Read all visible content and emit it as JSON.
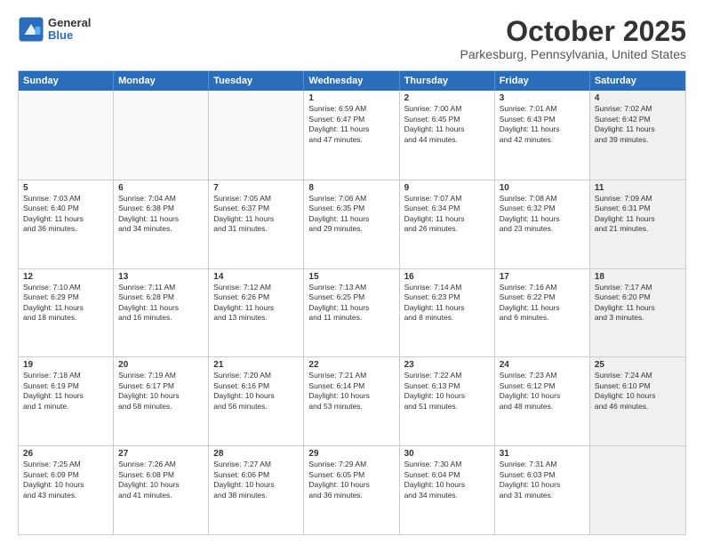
{
  "logo": {
    "general": "General",
    "blue": "Blue"
  },
  "title": {
    "month": "October 2025",
    "location": "Parkesburg, Pennsylvania, United States"
  },
  "calendar": {
    "headers": [
      "Sunday",
      "Monday",
      "Tuesday",
      "Wednesday",
      "Thursday",
      "Friday",
      "Saturday"
    ],
    "rows": [
      [
        {
          "day": "",
          "info": "",
          "empty": true
        },
        {
          "day": "",
          "info": "",
          "empty": true
        },
        {
          "day": "",
          "info": "",
          "empty": true
        },
        {
          "day": "1",
          "info": "Sunrise: 6:59 AM\nSunset: 6:47 PM\nDaylight: 11 hours\nand 47 minutes."
        },
        {
          "day": "2",
          "info": "Sunrise: 7:00 AM\nSunset: 6:45 PM\nDaylight: 11 hours\nand 44 minutes."
        },
        {
          "day": "3",
          "info": "Sunrise: 7:01 AM\nSunset: 6:43 PM\nDaylight: 11 hours\nand 42 minutes."
        },
        {
          "day": "4",
          "info": "Sunrise: 7:02 AM\nSunset: 6:42 PM\nDaylight: 11 hours\nand 39 minutes.",
          "shaded": true
        }
      ],
      [
        {
          "day": "5",
          "info": "Sunrise: 7:03 AM\nSunset: 6:40 PM\nDaylight: 11 hours\nand 36 minutes."
        },
        {
          "day": "6",
          "info": "Sunrise: 7:04 AM\nSunset: 6:38 PM\nDaylight: 11 hours\nand 34 minutes."
        },
        {
          "day": "7",
          "info": "Sunrise: 7:05 AM\nSunset: 6:37 PM\nDaylight: 11 hours\nand 31 minutes."
        },
        {
          "day": "8",
          "info": "Sunrise: 7:06 AM\nSunset: 6:35 PM\nDaylight: 11 hours\nand 29 minutes."
        },
        {
          "day": "9",
          "info": "Sunrise: 7:07 AM\nSunset: 6:34 PM\nDaylight: 11 hours\nand 26 minutes."
        },
        {
          "day": "10",
          "info": "Sunrise: 7:08 AM\nSunset: 6:32 PM\nDaylight: 11 hours\nand 23 minutes."
        },
        {
          "day": "11",
          "info": "Sunrise: 7:09 AM\nSunset: 6:31 PM\nDaylight: 11 hours\nand 21 minutes.",
          "shaded": true
        }
      ],
      [
        {
          "day": "12",
          "info": "Sunrise: 7:10 AM\nSunset: 6:29 PM\nDaylight: 11 hours\nand 18 minutes."
        },
        {
          "day": "13",
          "info": "Sunrise: 7:11 AM\nSunset: 6:28 PM\nDaylight: 11 hours\nand 16 minutes."
        },
        {
          "day": "14",
          "info": "Sunrise: 7:12 AM\nSunset: 6:26 PM\nDaylight: 11 hours\nand 13 minutes."
        },
        {
          "day": "15",
          "info": "Sunrise: 7:13 AM\nSunset: 6:25 PM\nDaylight: 11 hours\nand 11 minutes."
        },
        {
          "day": "16",
          "info": "Sunrise: 7:14 AM\nSunset: 6:23 PM\nDaylight: 11 hours\nand 8 minutes."
        },
        {
          "day": "17",
          "info": "Sunrise: 7:16 AM\nSunset: 6:22 PM\nDaylight: 11 hours\nand 6 minutes."
        },
        {
          "day": "18",
          "info": "Sunrise: 7:17 AM\nSunset: 6:20 PM\nDaylight: 11 hours\nand 3 minutes.",
          "shaded": true
        }
      ],
      [
        {
          "day": "19",
          "info": "Sunrise: 7:18 AM\nSunset: 6:19 PM\nDaylight: 11 hours\nand 1 minute."
        },
        {
          "day": "20",
          "info": "Sunrise: 7:19 AM\nSunset: 6:17 PM\nDaylight: 10 hours\nand 58 minutes."
        },
        {
          "day": "21",
          "info": "Sunrise: 7:20 AM\nSunset: 6:16 PM\nDaylight: 10 hours\nand 56 minutes."
        },
        {
          "day": "22",
          "info": "Sunrise: 7:21 AM\nSunset: 6:14 PM\nDaylight: 10 hours\nand 53 minutes."
        },
        {
          "day": "23",
          "info": "Sunrise: 7:22 AM\nSunset: 6:13 PM\nDaylight: 10 hours\nand 51 minutes."
        },
        {
          "day": "24",
          "info": "Sunrise: 7:23 AM\nSunset: 6:12 PM\nDaylight: 10 hours\nand 48 minutes."
        },
        {
          "day": "25",
          "info": "Sunrise: 7:24 AM\nSunset: 6:10 PM\nDaylight: 10 hours\nand 46 minutes.",
          "shaded": true
        }
      ],
      [
        {
          "day": "26",
          "info": "Sunrise: 7:25 AM\nSunset: 6:09 PM\nDaylight: 10 hours\nand 43 minutes."
        },
        {
          "day": "27",
          "info": "Sunrise: 7:26 AM\nSunset: 6:08 PM\nDaylight: 10 hours\nand 41 minutes."
        },
        {
          "day": "28",
          "info": "Sunrise: 7:27 AM\nSunset: 6:06 PM\nDaylight: 10 hours\nand 38 minutes."
        },
        {
          "day": "29",
          "info": "Sunrise: 7:29 AM\nSunset: 6:05 PM\nDaylight: 10 hours\nand 36 minutes."
        },
        {
          "day": "30",
          "info": "Sunrise: 7:30 AM\nSunset: 6:04 PM\nDaylight: 10 hours\nand 34 minutes."
        },
        {
          "day": "31",
          "info": "Sunrise: 7:31 AM\nSunset: 6:03 PM\nDaylight: 10 hours\nand 31 minutes."
        },
        {
          "day": "",
          "info": "",
          "empty": true,
          "shaded": true
        }
      ]
    ]
  }
}
